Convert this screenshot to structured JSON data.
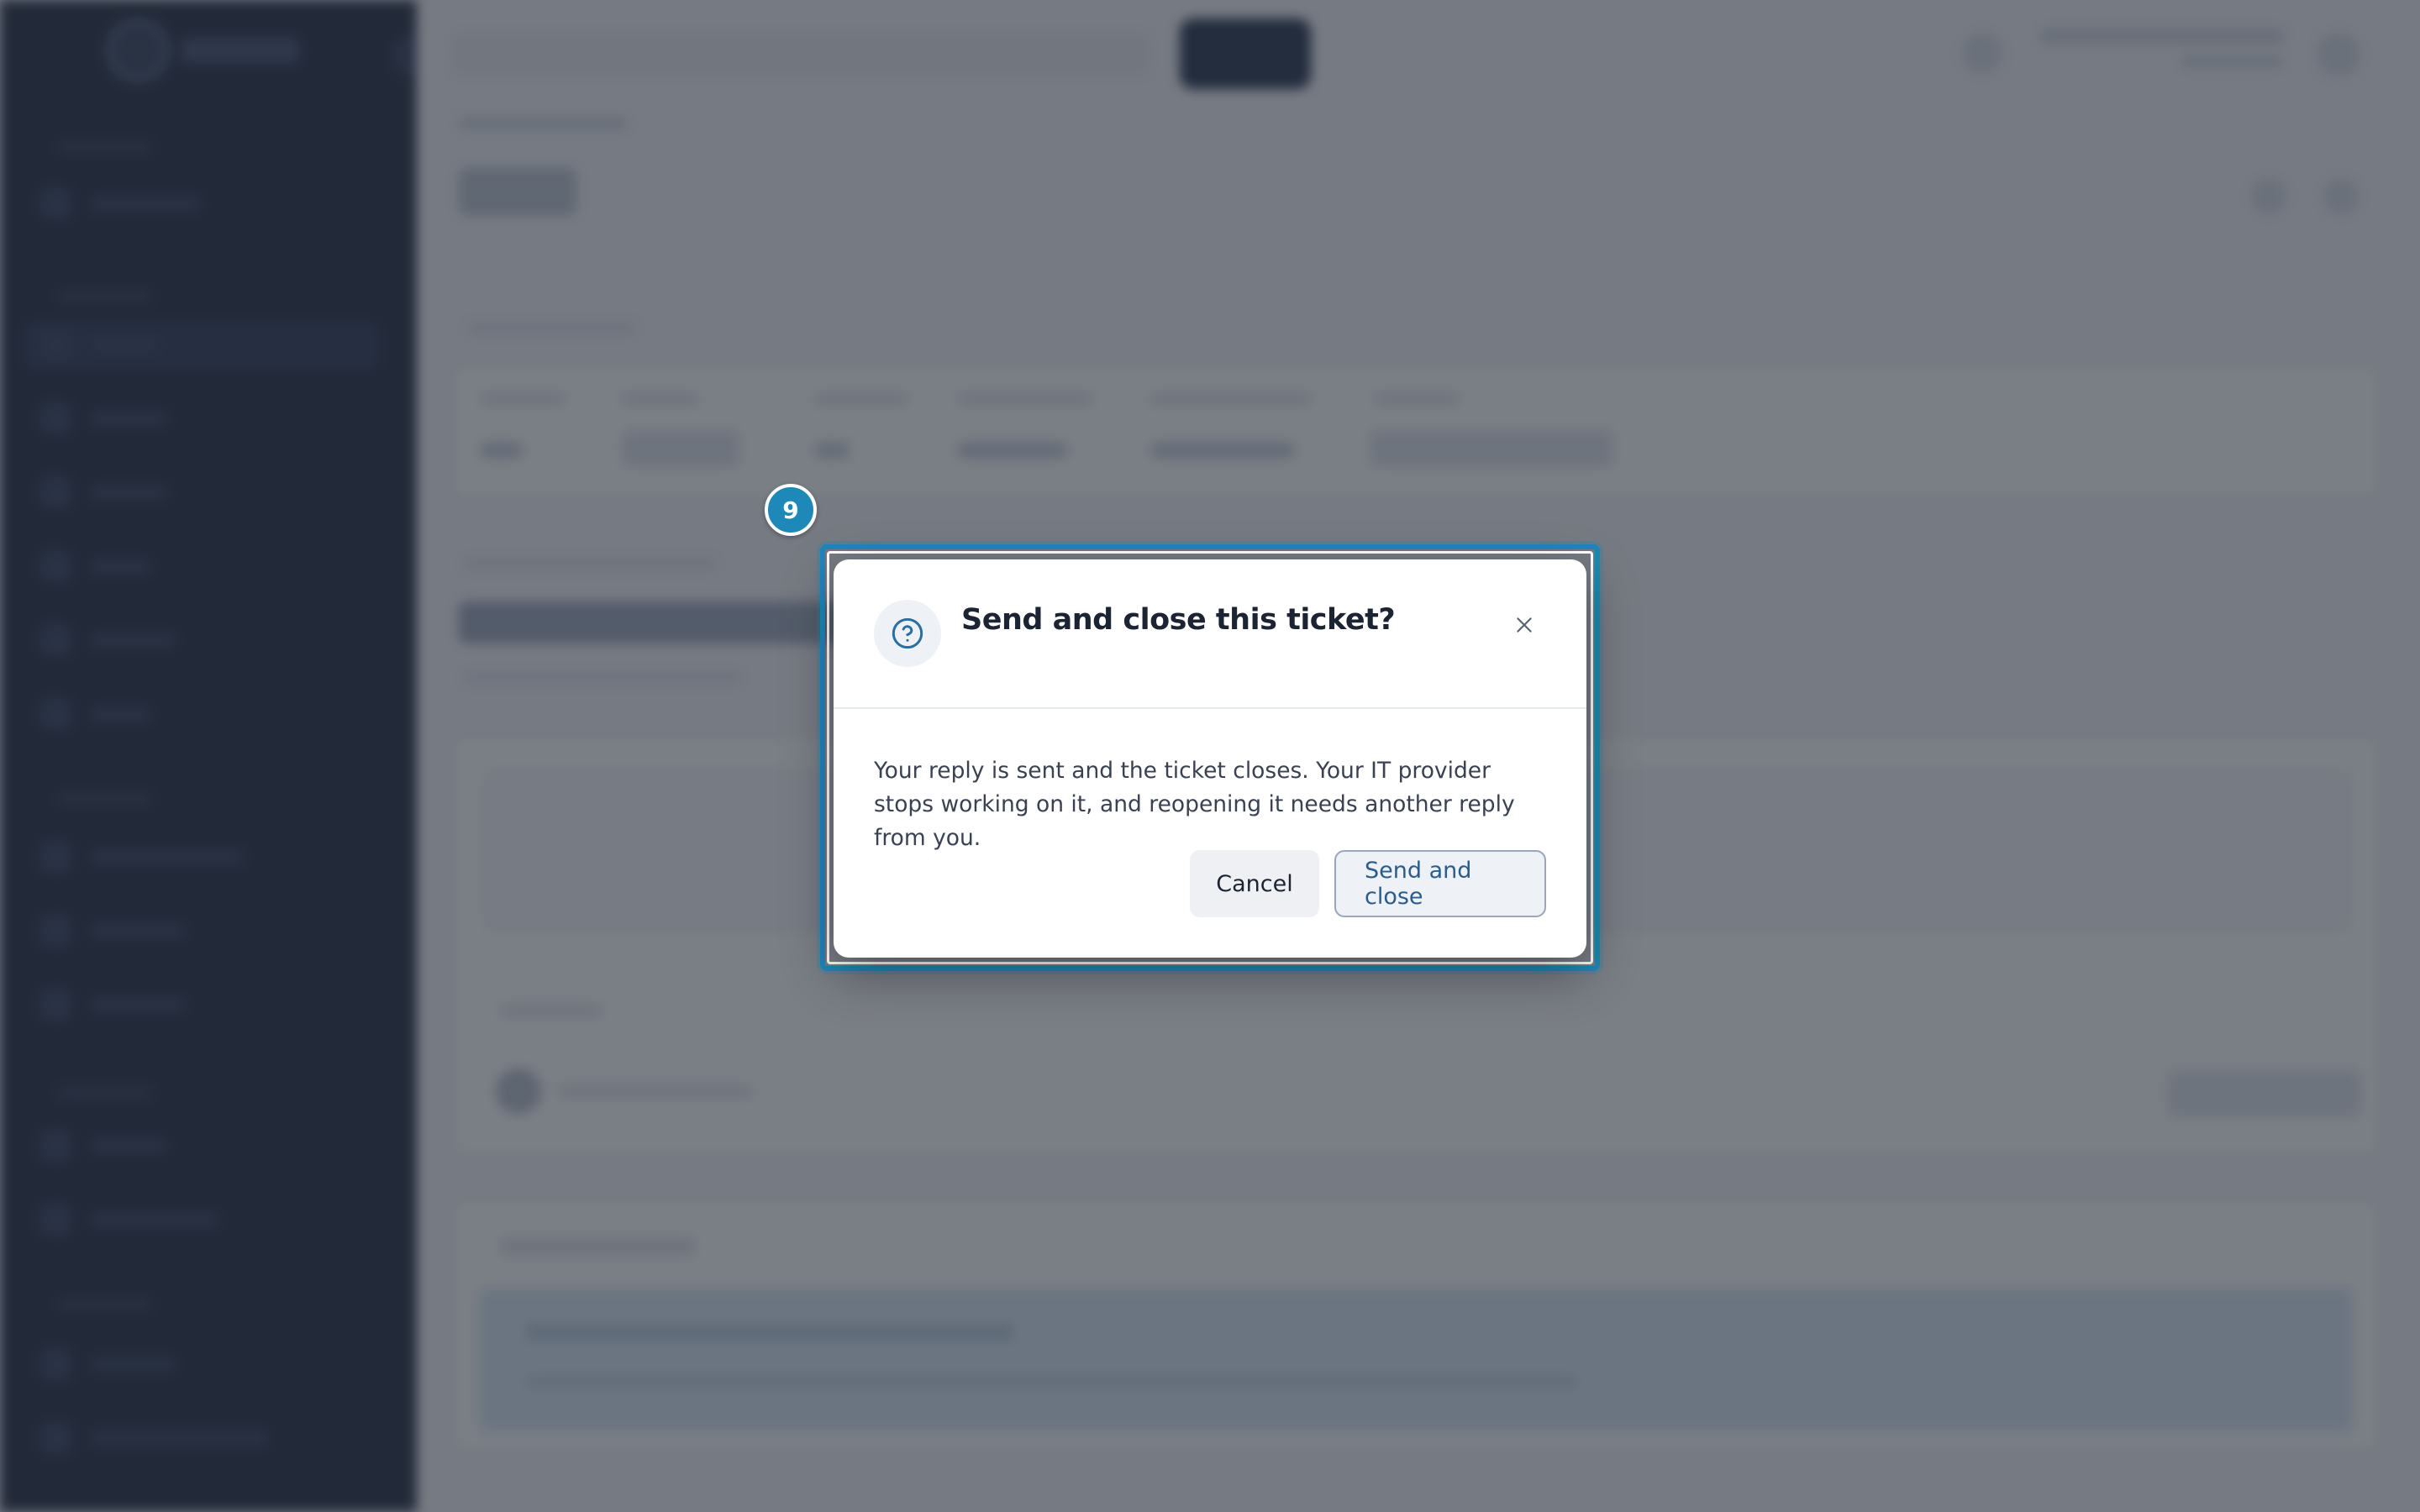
{
  "step": {
    "number": "9"
  },
  "dialog": {
    "title": "Send and close this ticket?",
    "icon": "question-circle-icon",
    "close_icon": "close-icon",
    "body": "Your reply is sent and the ticket closes. Your IT provider stops working on it, and reopening it needs another reply from you.",
    "cancel_label": "Cancel",
    "confirm_label": "Send and close"
  },
  "colors": {
    "accent": "#1e88b9",
    "sidebar": "#1a2438",
    "confirm_text": "#2a5d8c"
  }
}
